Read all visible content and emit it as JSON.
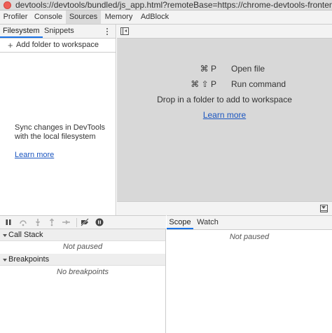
{
  "window": {
    "url": "devtools://devtools/bundled/js_app.html?remoteBase=https://chrome-devtools-frontend.apps..."
  },
  "main_tabs": [
    "Profiler",
    "Console",
    "Sources",
    "Memory",
    "AdBlock"
  ],
  "active_main_tab": "Sources",
  "navigator": {
    "tabs": [
      "Filesystem",
      "Snippets"
    ],
    "active_tab": "Filesystem",
    "add_folder": "Add folder to workspace",
    "empty_text": "Sync changes in DevTools with the local filesystem",
    "learn_more": "Learn more"
  },
  "editor": {
    "shortcuts": [
      {
        "keys": "⌘ P",
        "label": "Open file"
      },
      {
        "keys": "⌘ ⇧ P",
        "label": "Run command"
      }
    ],
    "drop_text": "Drop in a folder to add to workspace",
    "learn_more": "Learn more"
  },
  "debugger": {
    "call_stack": {
      "title": "Call Stack",
      "status": "Not paused"
    },
    "breakpoints": {
      "title": "Breakpoints",
      "status": "No breakpoints"
    }
  },
  "sidebar_pane": {
    "tabs": [
      "Scope",
      "Watch"
    ],
    "active_tab": "Scope",
    "status": "Not paused"
  },
  "colors": {
    "link": "#1a55c0",
    "active_tab_underline": "#1a73e8",
    "editor_background": "#d8d8d8"
  }
}
